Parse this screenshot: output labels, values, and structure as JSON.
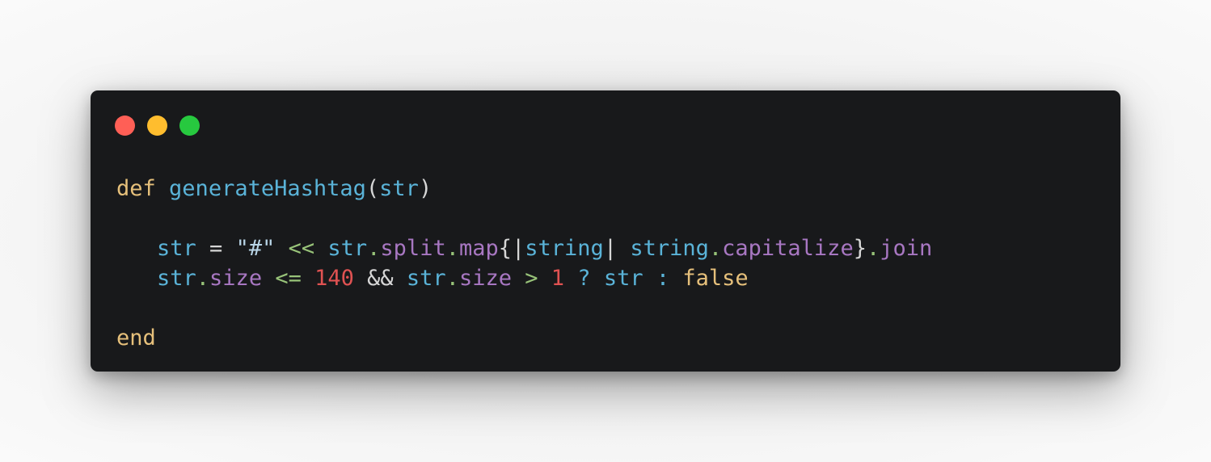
{
  "window": {
    "controls": {
      "close_color": "#ff5f56",
      "minimize_color": "#ffbd2e",
      "maximize_color": "#27c93f"
    }
  },
  "code": {
    "line1": {
      "def": "def",
      "name": "generateHashtag",
      "open": "(",
      "param": "str",
      "close": ")"
    },
    "line2": {
      "var": "str",
      "assign": " = ",
      "string": "\"#\"",
      "shovel": " << ",
      "recv": "str",
      "dot1": ".",
      "split": "split",
      "dot2": ".",
      "map": "map",
      "brace_open": "{|",
      "blockvar": "string",
      "pipe": "| ",
      "recv2": "string",
      "dot3": ".",
      "capitalize": "capitalize",
      "brace_close": "}",
      "dot4": ".",
      "join": "join"
    },
    "line3": {
      "recv": "str",
      "dot1": ".",
      "size": "size",
      "lte": " <= ",
      "num140": "140",
      "and": " && ",
      "recv2": "str",
      "dot2": ".",
      "size2": "size",
      "gt": " > ",
      "num1": "1",
      "q": " ? ",
      "str": "str",
      "colon": " : ",
      "false": "false"
    },
    "line4": {
      "end": "end"
    }
  }
}
